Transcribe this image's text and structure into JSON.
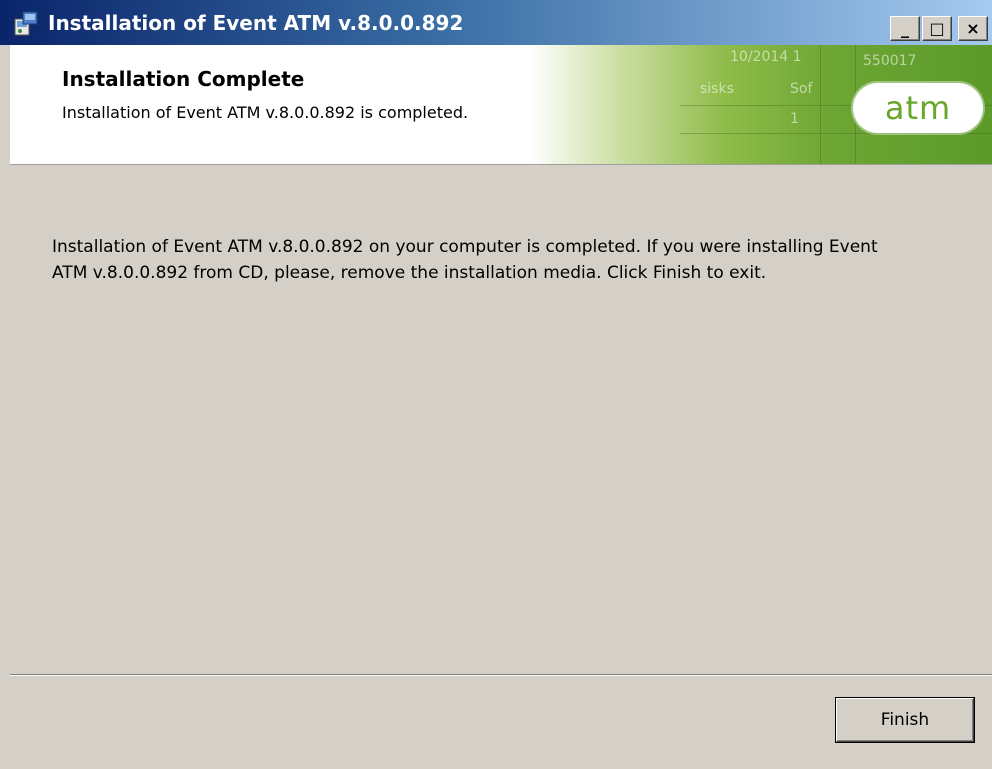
{
  "window": {
    "title": "Installation of Event ATM v.8.0.0.892",
    "controls": {
      "minimize": "_",
      "maximize": "□",
      "close": "×"
    }
  },
  "banner": {
    "heading": "Installation Complete",
    "subheading": "Installation of Event ATM v.8.0.0.892 is completed.",
    "logo_text": "atm",
    "background_text": [
      "10/2014 1",
      "550017",
      "sisks",
      "Sof",
      "1"
    ]
  },
  "main": {
    "message": "Installation of Event ATM v.8.0.0.892 on your computer is completed. If you were installing Event ATM v.8.0.0.892 from CD, please, remove the installation media. Click Finish to exit."
  },
  "footer": {
    "finish_label": "Finish"
  },
  "colors": {
    "titlebar_start": "#0a246a",
    "titlebar_end": "#a6caf0",
    "dialog_bg": "#d4d0c8",
    "brand_green": "#6aa62b"
  }
}
